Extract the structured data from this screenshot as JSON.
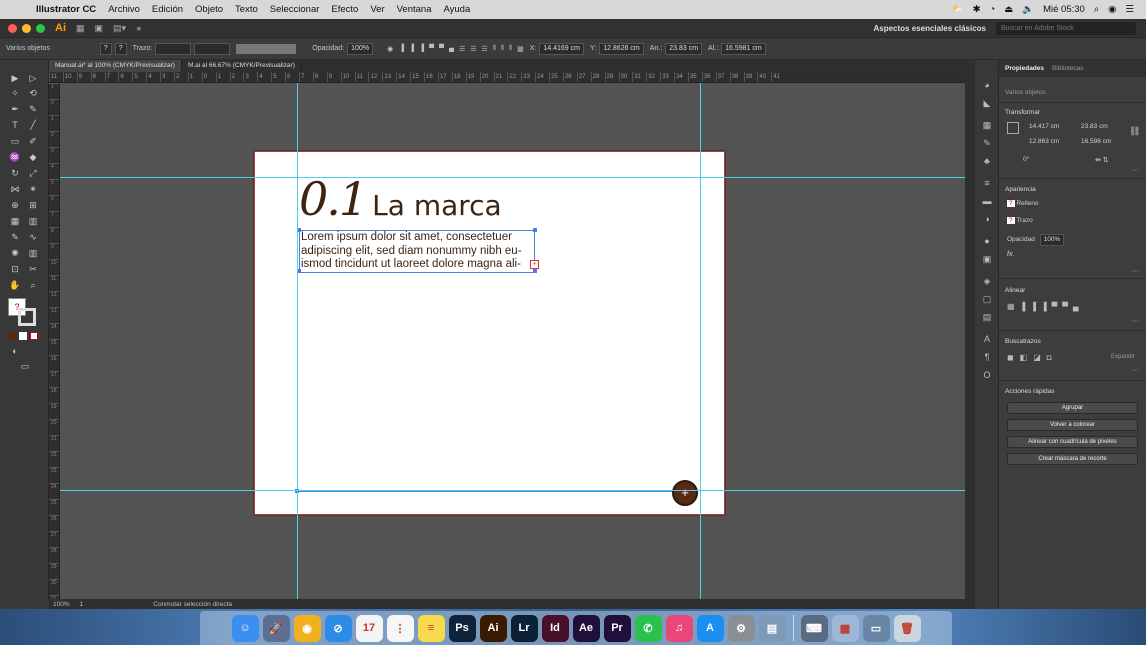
{
  "menubar": {
    "app_name": "Illustrator CC",
    "items": [
      "Archivo",
      "Edición",
      "Objeto",
      "Texto",
      "Seleccionar",
      "Efecto",
      "Ver",
      "Ventana",
      "Ayuda"
    ],
    "clock": "Mié 05:30"
  },
  "appbar": {
    "logo": "Ai",
    "workspace": "Aspectos esenciales clásicos",
    "stock_placeholder": "Buscar en Adobe Stock"
  },
  "control": {
    "selection_label": "Varios objetos",
    "stroke_label": "Trazo:",
    "opacity_label": "Opacidad:",
    "opacity_value": "100%",
    "x_label": "X:",
    "x_value": "14.4169 cm",
    "y_label": "Y:",
    "y_value": "12.8626 cm",
    "w_label": "An.:",
    "w_value": "23.83 cm",
    "h_label": "Al.:",
    "h_value": "16.5981 cm"
  },
  "tabs": [
    {
      "label": "Manual.ai* al 100% (CMYK/Previsualizar)",
      "active": true
    },
    {
      "label": "M.ai al 66.67% (CMYK/Previsualizar)",
      "active": false
    }
  ],
  "ruler_h": [
    "11",
    "10",
    "9",
    "8",
    "7",
    "6",
    "5",
    "4",
    "3",
    "2",
    "1",
    "0",
    "1",
    "2",
    "3",
    "4",
    "5",
    "6",
    "7",
    "8",
    "9",
    "10",
    "11",
    "12",
    "13",
    "14",
    "15",
    "16",
    "17",
    "18",
    "19",
    "20",
    "21",
    "22",
    "23",
    "24",
    "25",
    "26",
    "27",
    "28",
    "29",
    "30",
    "31",
    "32",
    "33",
    "34",
    "35",
    "36",
    "37",
    "38",
    "39",
    "40",
    "41"
  ],
  "ruler_v": [
    "1",
    "0",
    "1",
    "2",
    "3",
    "4",
    "5",
    "6",
    "7",
    "8",
    "9",
    "10",
    "11",
    "12",
    "13",
    "14",
    "15",
    "16",
    "17",
    "18",
    "19",
    "20",
    "21",
    "22",
    "23",
    "24",
    "25",
    "26",
    "27",
    "28",
    "29",
    "30",
    "31"
  ],
  "artboard": {
    "title_number": "0.1",
    "title_word": "La marca",
    "body": "Lorem ipsum dolor sit amet, consectetuer adipiscing elit, sed diam nonummy nibh eu-ismod tincidunt ut laoreet dolore magna ali-",
    "badge_icon": "plus-icon"
  },
  "statusbar": {
    "zoom": "100%",
    "page": "1",
    "mode": "Conmutar selección directa"
  },
  "panel": {
    "tab_props": "Propiedades",
    "tab_libs": "Bibliotecas",
    "selection": "Varios objetos",
    "transform_title": "Transformar",
    "x": "14.417 cm",
    "y": "12.863 cm",
    "w": "23.83 cm",
    "h": "16.598 cm",
    "angle": "0°",
    "appearance_title": "Apariencia",
    "fill_label": "Relleno",
    "stroke_label": "Trazo",
    "opacity_label": "Opacidad",
    "opacity_value": "100%",
    "fx": "fx.",
    "align_title": "Alinear",
    "pathfinder_title": "Buscatrazos",
    "expand_label": "Expandir",
    "quick_title": "Acciones rápidas",
    "btn_group": "Agrupar",
    "btn_recolor": "Volver a colorear",
    "btn_pixel": "Alinear con cuadrícula de píxeles",
    "btn_mask": "Crear máscara de recorte"
  },
  "dock": [
    {
      "name": "finder-icon",
      "glyph": "☺",
      "color": "#3c8ef0"
    },
    {
      "name": "launchpad-icon",
      "glyph": "🚀",
      "color": "#5c6e91"
    },
    {
      "name": "chrome-icon",
      "glyph": "◉",
      "color": "#f0b020"
    },
    {
      "name": "safari-icon",
      "glyph": "⊘",
      "color": "#2d8ce8"
    },
    {
      "name": "calendar-icon",
      "glyph": "17",
      "color": "#f4f4f4"
    },
    {
      "name": "reminders-icon",
      "glyph": "⋮",
      "color": "#f6f6f6"
    },
    {
      "name": "notes-icon",
      "glyph": "≡",
      "color": "#f7d94d"
    },
    {
      "name": "photoshop-icon",
      "glyph": "Ps",
      "color": "#0e2239"
    },
    {
      "name": "illustrator-icon",
      "glyph": "Ai",
      "color": "#3a1a00"
    },
    {
      "name": "lightroom-icon",
      "glyph": "Lr",
      "color": "#0d2135"
    },
    {
      "name": "indesign-icon",
      "glyph": "Id",
      "color": "#4a0f2a"
    },
    {
      "name": "aftereffects-icon",
      "glyph": "Ae",
      "color": "#1f0f3a"
    },
    {
      "name": "premiere-icon",
      "glyph": "Pr",
      "color": "#1f0f3a"
    },
    {
      "name": "whatsapp-icon",
      "glyph": "✆",
      "color": "#2bc14d"
    },
    {
      "name": "itunes-icon",
      "glyph": "♫",
      "color": "#e9477a"
    },
    {
      "name": "appstore-icon",
      "glyph": "A",
      "color": "#1b8ef2"
    },
    {
      "name": "system-preferences-icon",
      "glyph": "⚙",
      "color": "#8a8f96"
    },
    {
      "name": "preview-icon",
      "glyph": "▤",
      "color": "#7d9bb8"
    },
    {
      "name": "keyboard-viewer-icon",
      "glyph": "⌨",
      "color": "#5a6a80"
    },
    {
      "name": "photoshop-file-icon",
      "glyph": "▦",
      "color": "#9db8d6"
    },
    {
      "name": "screen-window-icon",
      "glyph": "▭",
      "color": "#6a86a6"
    },
    {
      "name": "trash-icon",
      "glyph": "🗑",
      "color": "#cdd5df"
    }
  ]
}
